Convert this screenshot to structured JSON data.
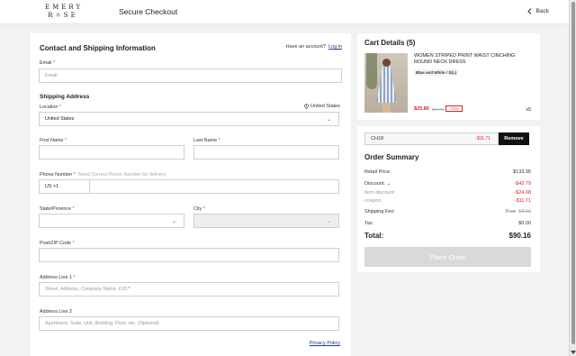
{
  "header": {
    "logo_line1": "EMERY",
    "logo_line2": "R☼SE",
    "title": "Secure Checkout",
    "back_label": "Back",
    "back_icon": "chevron-left-icon"
  },
  "form": {
    "title": "Contact and Shipping Information",
    "account_prompt": "Have an account?",
    "login_label": "Log in",
    "email_label": "Email",
    "email_placeholder": "Email",
    "shipping_title": "Shipping Address",
    "location_label": "Location",
    "location_value": "United States",
    "location_right": "United States",
    "first_name_label": "First Name",
    "last_name_label": "Last Name",
    "phone_label": "Phone Number",
    "phone_hint": "Need Correct Phone Number for delivery",
    "phone_code": "US +1",
    "state_label": "State/Province",
    "city_label": "City",
    "zip_label": "Post/ZIP Code",
    "address1_label": "Address Line 1",
    "address1_placeholder": "Street, Address, Company Name, C/O",
    "address2_label": "Address Line 2",
    "address2_placeholder": "Apartment, Suite, Unit, Building, Floor, etc. (Optional)",
    "privacy_label": "Privacy Policy",
    "required_mark": "*"
  },
  "cart": {
    "title": "Cart Details (5)",
    "product_name": "WOMEN STRIPED PRINT WAIST CINCHING ROUND NECK DRESS",
    "variant": "Blue and White / S(L)",
    "sale_price": "$25.85",
    "original_price": "$77.44",
    "discount": "-71%",
    "quantity": "x5"
  },
  "summary": {
    "coupon_code": "CH18",
    "coupon_amount": "-$11.71",
    "remove_label": "Remove",
    "title": "Order Summary",
    "retail_label": "Retail Price:",
    "retail_value": "$133.95",
    "discount_label": "Discount:",
    "discount_value": "-$43.79",
    "item_discount_label": "Item discount:",
    "item_discount_value": "-$24.08",
    "coupon_label": "coupon:",
    "coupon_value": "-$11.71",
    "shipping_label": "Shipping Fee:",
    "shipping_free": "Free",
    "shipping_original": "$8.00",
    "tax_label": "Tax:",
    "tax_value": "$0.00",
    "total_label": "Total:",
    "total_value": "$90.16",
    "place_order_label": "Place Order"
  },
  "colors": {
    "accent_red": "#d22222",
    "button_dark": "#111111",
    "link_blue": "#1d3b8a",
    "free_green": "#2a8a3a"
  }
}
